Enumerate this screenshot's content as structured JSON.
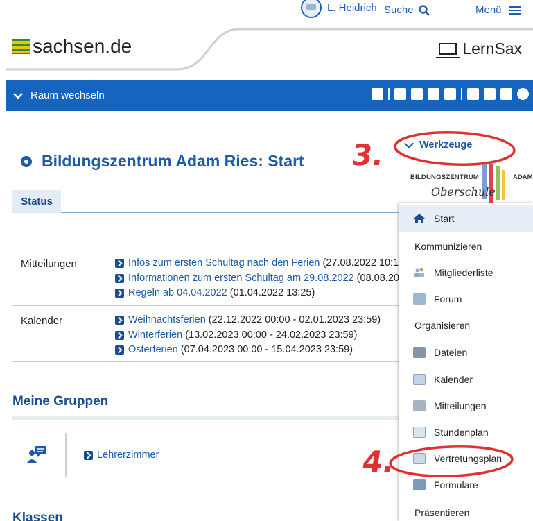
{
  "topbar": {
    "user": "L. Heidrich",
    "search": "Suche",
    "menu": "Menü"
  },
  "header": {
    "site": "sachsen.de",
    "app": "LernSax"
  },
  "roombar": {
    "toggle": "Raum wechseln"
  },
  "page": {
    "title": "Bildungszentrum Adam Ries: Start",
    "tab": "Status",
    "mitteilungen_label": "Mitteilungen",
    "mitteilungen": [
      {
        "link": "Infos zum ersten Schultag nach den Ferien",
        "meta": " (27.08.2022 10:1"
      },
      {
        "link": "Informationen zum ersten Schultag am 29.08.2022",
        "meta": " (08.08.20"
      },
      {
        "link": "Regeln ab 04.04.2022",
        "meta": " (01.04.2022 13:25)"
      }
    ],
    "kalender_label": "Kalender",
    "kalender": [
      {
        "link": "Weihnachtsferien",
        "meta": " (22.12.2022 00:00 - 02.01.2023 23:59)"
      },
      {
        "link": "Winterferien",
        "meta": " (13.02.2023 00:00 - 24.02.2023 23:59)"
      },
      {
        "link": "Osterferien",
        "meta": " (07.04.2023 00:00 - 15.04.2023 23:59)"
      }
    ],
    "gruppen_title": "Meine Gruppen",
    "gruppe": "Lehrerzimmer",
    "klassen_title": "Klassen"
  },
  "tools": {
    "title": "Werkzeuge",
    "school_line1": "BILDUNGSZENTRUM",
    "school_line2": "ADAM",
    "school_line3": "Oberschule",
    "start": "Start",
    "kommunizieren": "Kommunizieren",
    "mitgliederliste": "Mitgliederliste",
    "forum": "Forum",
    "organisieren": "Organisieren",
    "dateien": "Dateien",
    "kalender": "Kalender",
    "mitteilungen": "Mitteilungen",
    "stundenplan": "Stundenplan",
    "vertretungsplan": "Vertretungsplan",
    "formulare": "Formulare",
    "praesentieren": "Präsentieren"
  },
  "annotations": {
    "step3": "3.",
    "step4": "4."
  },
  "colors": {
    "primary": "#1565c0",
    "link": "#1b5aa6",
    "annotation": "#e03030"
  }
}
